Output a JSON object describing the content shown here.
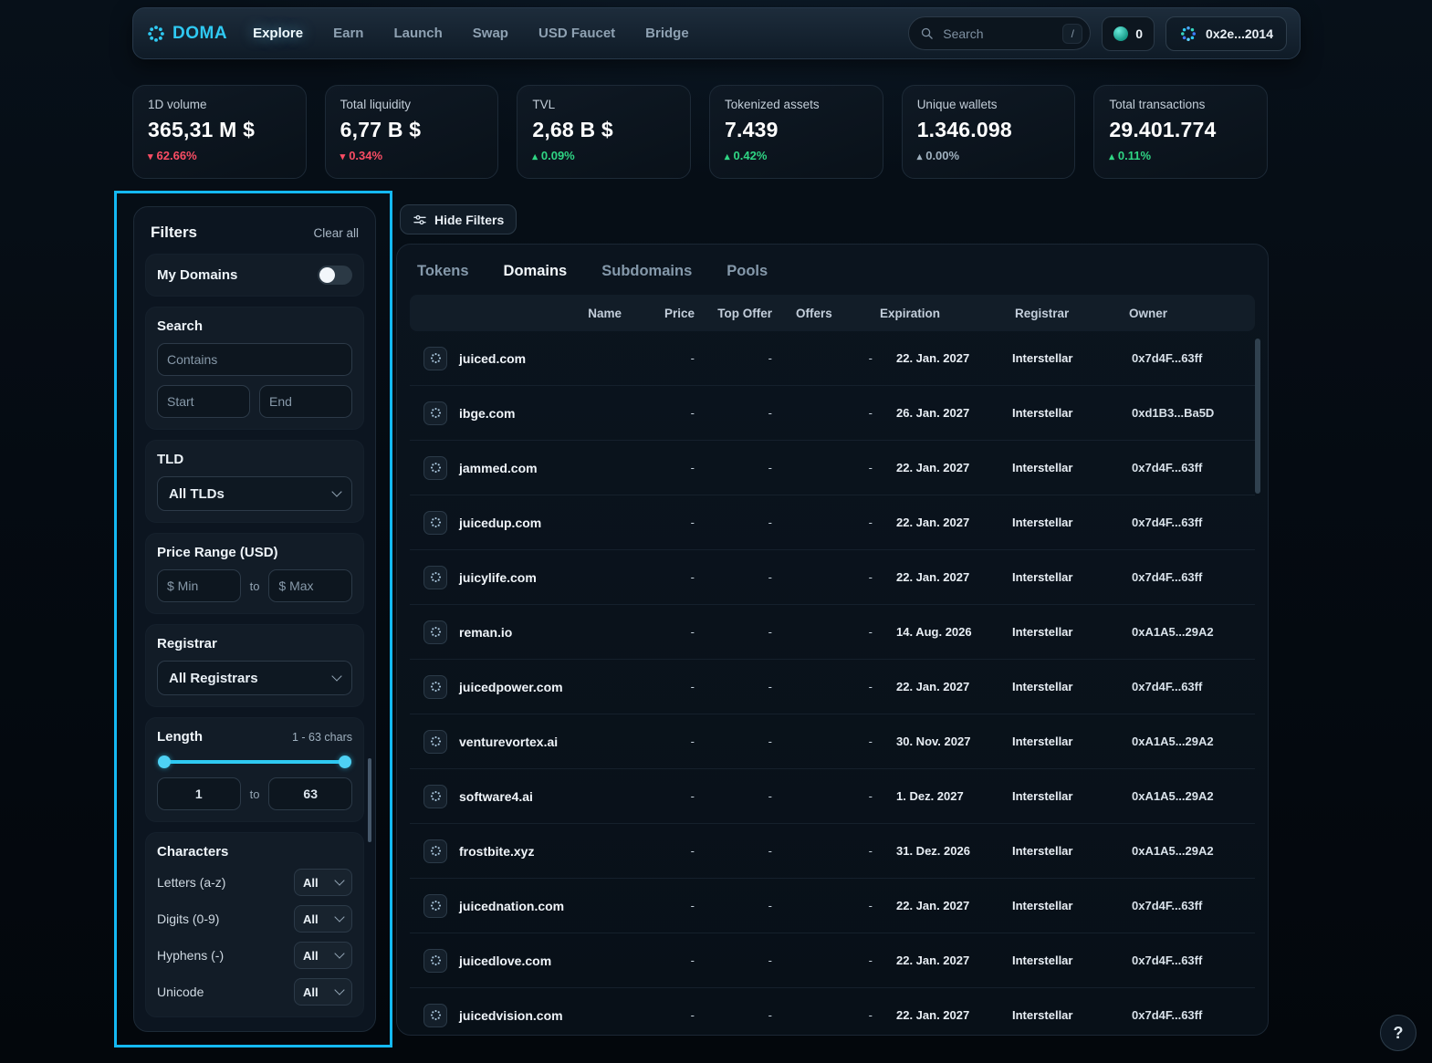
{
  "colors": {
    "accent": "#2fc9f2",
    "positive": "#2fd584",
    "negative": "#fb4d64",
    "annotation": "#14b9f4",
    "neutral": "#9fb0be"
  },
  "navbar": {
    "brand": "DOMA",
    "items": [
      {
        "label": "Explore",
        "active": true
      },
      {
        "label": "Earn"
      },
      {
        "label": "Launch"
      },
      {
        "label": "Swap"
      },
      {
        "label": "USD Faucet"
      },
      {
        "label": "Bridge"
      }
    ],
    "search_placeholder": "Search",
    "search_shortcut": "/",
    "token_count": "0",
    "wallet_address": "0x2e...2014"
  },
  "stats": [
    {
      "label": "1D volume",
      "value": "365,31 M $",
      "change": "62.66%",
      "direction": "down"
    },
    {
      "label": "Total liquidity",
      "value": "6,77 B $",
      "change": "0.34%",
      "direction": "down"
    },
    {
      "label": "TVL",
      "value": "2,68 B $",
      "change": "0.09%",
      "direction": "up"
    },
    {
      "label": "Tokenized assets",
      "value": "7.439",
      "change": "0.42%",
      "direction": "up"
    },
    {
      "label": "Unique wallets",
      "value": "1.346.098",
      "change": "0.00%",
      "direction": "neutral"
    },
    {
      "label": "Total transactions",
      "value": "29.401.774",
      "change": "0.11%",
      "direction": "up"
    }
  ],
  "filters": {
    "title": "Filters",
    "clear_all": "Clear all",
    "my_domains_label": "My Domains",
    "search": {
      "title": "Search",
      "contains_placeholder": "Contains",
      "start_placeholder": "Start",
      "end_placeholder": "End"
    },
    "tld": {
      "title": "TLD",
      "value": "All TLDs"
    },
    "price_range": {
      "title": "Price Range (USD)",
      "min_placeholder": "$ Min",
      "to": "to",
      "max_placeholder": "$ Max"
    },
    "registrar": {
      "title": "Registrar",
      "value": "All Registrars"
    },
    "length": {
      "title": "Length",
      "hint": "1 - 63 chars",
      "min": "1",
      "to": "to",
      "max": "63"
    },
    "characters": {
      "title": "Characters",
      "rows": [
        {
          "label": "Letters (a-z)",
          "value": "All"
        },
        {
          "label": "Digits (0-9)",
          "value": "All"
        },
        {
          "label": "Hyphens (-)",
          "value": "All"
        },
        {
          "label": "Unicode",
          "value": "All"
        }
      ]
    }
  },
  "main": {
    "hide_filters_label": "Hide Filters",
    "tabs": [
      {
        "label": "Tokens"
      },
      {
        "label": "Domains",
        "active": true
      },
      {
        "label": "Subdomains"
      },
      {
        "label": "Pools"
      }
    ],
    "table": {
      "columns": [
        "Name",
        "Price",
        "Top Offer",
        "Offers",
        "Expiration",
        "Registrar",
        "Owner"
      ],
      "rows": [
        {
          "name": "juiced.com",
          "price": "-",
          "top_offer": "-",
          "offers": "-",
          "expiration": "22. Jan. 2027",
          "registrar": "Interstellar",
          "owner": "0x7d4F...63ff"
        },
        {
          "name": "ibge.com",
          "price": "-",
          "top_offer": "-",
          "offers": "-",
          "expiration": "26. Jan. 2027",
          "registrar": "Interstellar",
          "owner": "0xd1B3...Ba5D"
        },
        {
          "name": "jammed.com",
          "price": "-",
          "top_offer": "-",
          "offers": "-",
          "expiration": "22. Jan. 2027",
          "registrar": "Interstellar",
          "owner": "0x7d4F...63ff"
        },
        {
          "name": "juicedup.com",
          "price": "-",
          "top_offer": "-",
          "offers": "-",
          "expiration": "22. Jan. 2027",
          "registrar": "Interstellar",
          "owner": "0x7d4F...63ff"
        },
        {
          "name": "juicylife.com",
          "price": "-",
          "top_offer": "-",
          "offers": "-",
          "expiration": "22. Jan. 2027",
          "registrar": "Interstellar",
          "owner": "0x7d4F...63ff"
        },
        {
          "name": "reman.io",
          "price": "-",
          "top_offer": "-",
          "offers": "-",
          "expiration": "14. Aug. 2026",
          "registrar": "Interstellar",
          "owner": "0xA1A5...29A2"
        },
        {
          "name": "juicedpower.com",
          "price": "-",
          "top_offer": "-",
          "offers": "-",
          "expiration": "22. Jan. 2027",
          "registrar": "Interstellar",
          "owner": "0x7d4F...63ff"
        },
        {
          "name": "venturevortex.ai",
          "price": "-",
          "top_offer": "-",
          "offers": "-",
          "expiration": "30. Nov. 2027",
          "registrar": "Interstellar",
          "owner": "0xA1A5...29A2"
        },
        {
          "name": "software4.ai",
          "price": "-",
          "top_offer": "-",
          "offers": "-",
          "expiration": "1. Dez. 2027",
          "registrar": "Interstellar",
          "owner": "0xA1A5...29A2"
        },
        {
          "name": "frostbite.xyz",
          "price": "-",
          "top_offer": "-",
          "offers": "-",
          "expiration": "31. Dez. 2026",
          "registrar": "Interstellar",
          "owner": "0xA1A5...29A2"
        },
        {
          "name": "juicednation.com",
          "price": "-",
          "top_offer": "-",
          "offers": "-",
          "expiration": "22. Jan. 2027",
          "registrar": "Interstellar",
          "owner": "0x7d4F...63ff"
        },
        {
          "name": "juicedlove.com",
          "price": "-",
          "top_offer": "-",
          "offers": "-",
          "expiration": "22. Jan. 2027",
          "registrar": "Interstellar",
          "owner": "0x7d4F...63ff"
        },
        {
          "name": "juicedvision.com",
          "price": "-",
          "top_offer": "-",
          "offers": "-",
          "expiration": "22. Jan. 2027",
          "registrar": "Interstellar",
          "owner": "0x7d4F...63ff"
        }
      ]
    }
  },
  "help_label": "?"
}
